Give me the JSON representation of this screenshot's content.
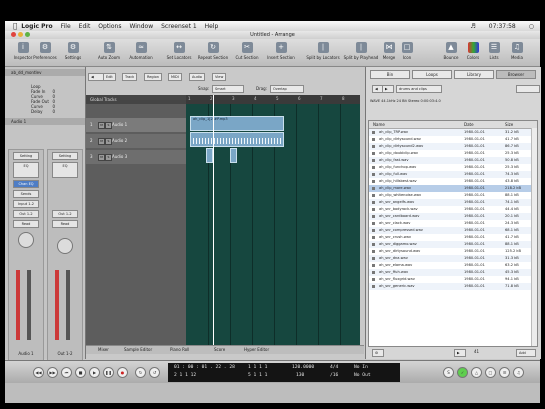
{
  "menubar": {
    "apple": "",
    "items": [
      "Logic Pro",
      "File",
      "Edit",
      "Options",
      "Window",
      "Screenset 1",
      "Help"
    ],
    "clock": "07:37:58"
  },
  "window": {
    "title": "Untitled - Arrange"
  },
  "toolbar": {
    "buttons": [
      "Inspector",
      "Preferences",
      "Settings",
      "Auto Zoom",
      "Automation",
      "Set Locators",
      "Repeat Section",
      "Cut Section",
      "Insert Section",
      "Split by Locators",
      "Split by Playhead",
      "Merge",
      "Icon",
      "Bounce",
      "Colors",
      "Lists",
      "Media"
    ]
  },
  "inspector": {
    "region_name": "ab_dd_montlev",
    "params": [
      {
        "label": "Loop",
        "value": ""
      },
      {
        "label": "Fade In",
        "value": "0"
      },
      {
        "label": "Curve",
        "value": "0"
      },
      {
        "label": "Fade Out",
        "value": "0"
      },
      {
        "label": "Curve",
        "value": "0"
      },
      {
        "label": "Delay",
        "value": "0"
      }
    ],
    "track_name": "Audio 1",
    "strip1": {
      "setting": "Setting",
      "eq": "EQ",
      "io": "Chan EQ",
      "sends": "Sends",
      "input": "Input 1-2",
      "output": "Out 1-2",
      "automation": "Read",
      "group": "Off",
      "name": "Audio 1"
    },
    "strip2": {
      "setting": "Setting",
      "eq": "EQ",
      "input": "Out 1-2",
      "automation": "Read",
      "name": "Out 1-2"
    }
  },
  "arrange": {
    "tool_buttons": [
      "Edit",
      "Track",
      "Region",
      "MIDI",
      "Audio",
      "View"
    ],
    "snap_label": "Snap:",
    "snap_value": "Smart",
    "drag_label": "Drag:",
    "drag_value": "Overlap",
    "global_tracks": "Global Tracks",
    "tracks": [
      {
        "num": "1",
        "name": "Audio 1"
      },
      {
        "num": "2",
        "name": "Audio 2"
      },
      {
        "num": "3",
        "name": "Audio 3"
      }
    ],
    "ruler": [
      "1",
      "2",
      "3",
      "4",
      "5",
      "6",
      "7",
      "8"
    ],
    "region_label": "ah_clip_1[2]#P.mp3",
    "bottom_tabs": [
      "Mixer",
      "Sample Editor",
      "Piano Roll",
      "Score",
      "Hyper Editor"
    ]
  },
  "browser": {
    "tabs": [
      "Bin",
      "Loops",
      "Library",
      "Browser"
    ],
    "path": "drums and clips",
    "info": "WAVE  44.1kHz  24 Bit  Stereo  0:00:03:4.0",
    "columns": [
      "Name",
      "Date",
      "Size"
    ],
    "files": [
      {
        "name": "ah_clip_TRP.wav",
        "date": "1980-01-01",
        "size": "31.2 kB"
      },
      {
        "name": "ah_clip_dirtysound.wav",
        "date": "1980-01-01",
        "size": "41.7 kB"
      },
      {
        "name": "ah_clip_dirtysound2.wav",
        "date": "1980-01-01",
        "size": "86.7 kB"
      },
      {
        "name": "ah_clip_doublclip.wav",
        "date": "1980-01-01",
        "size": "25.3 kB"
      },
      {
        "name": "ah_clip_fast.wav",
        "date": "1980-01-01",
        "size": "50.8 kB"
      },
      {
        "name": "ah_clip_funchop.wav",
        "date": "1980-01-01",
        "size": "25.3 kB"
      },
      {
        "name": "ah_clip_full.wav",
        "date": "1980-01-01",
        "size": "74.3 kB"
      },
      {
        "name": "ah_clip_hillsbest.wav",
        "date": "1980-01-01",
        "size": "43.8 kB"
      },
      {
        "name": "ah_clip_more.wav",
        "date": "1980-01-01",
        "size": "218.2 kB"
      },
      {
        "name": "ah_clip_whitenoise.wav",
        "date": "1980-01-01",
        "size": "88.1 kB"
      },
      {
        "name": "ah_snr_angelfs.wav",
        "date": "1980-01-01",
        "size": "74.1 kB"
      },
      {
        "name": "ah_snr_bodyrock.wav",
        "date": "1980-01-01",
        "size": "44.4 kB"
      },
      {
        "name": "ah_snr_cardboard.wav",
        "date": "1980-01-01",
        "size": "20.1 kB"
      },
      {
        "name": "ah_snr_clack.wav",
        "date": "1980-01-01",
        "size": "24.3 kB"
      },
      {
        "name": "ah_snr_compressed.wav",
        "date": "1980-01-01",
        "size": "68.1 kB"
      },
      {
        "name": "ah_snr_crush.wav",
        "date": "1980-01-01",
        "size": "41.7 kB"
      },
      {
        "name": "ah_snr_diggamo.wav",
        "date": "1980-01-01",
        "size": "88.1 kB"
      },
      {
        "name": "ah_snr_dirtysound.wav",
        "date": "1980-01-01",
        "size": "125.2 kB"
      },
      {
        "name": "ah_snr_dna.wav",
        "date": "1980-01-01",
        "size": "31.3 kB"
      },
      {
        "name": "ah_snr_elama.wav",
        "date": "1980-01-01",
        "size": "63.2 kB"
      },
      {
        "name": "ah_snr_ffuh.wav",
        "date": "1980-01-01",
        "size": "45.3 kB"
      },
      {
        "name": "ah_snr_fluxgrid.wav",
        "date": "1980-01-01",
        "size": "94.1 kB"
      },
      {
        "name": "ah_snr_generic.wav",
        "date": "1980-01-01",
        "size": "71.8 kB"
      }
    ],
    "selected_index": 8,
    "counter": "41",
    "add_label": "Add"
  },
  "transport": {
    "position_smpte": "01 : 00 : 01 . 22 . 28",
    "position_bars": "2  1  1  12",
    "locator_left": "1  1  1  1",
    "locator_right": "5  1  1  1",
    "tempo": "120.0000",
    "tempo_sub": "130",
    "signature": "4/4",
    "division": "/16",
    "in_label": "No In",
    "out_label": "No Out"
  }
}
